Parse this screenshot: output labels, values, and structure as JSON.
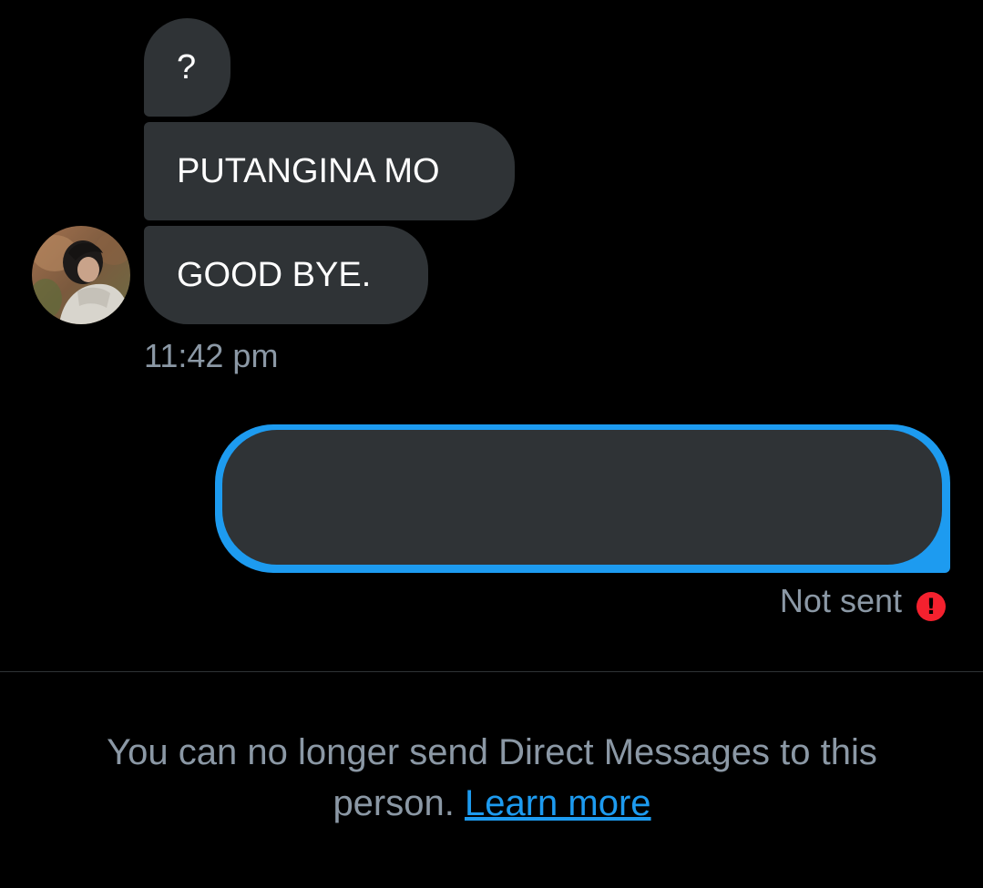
{
  "conversation": {
    "messages_received": [
      {
        "text": "?"
      },
      {
        "text": "PUTANGINA MO"
      },
      {
        "text": "GOOD BYE."
      }
    ],
    "received_timestamp": "11:42 pm",
    "sent_message": {
      "text": "",
      "status": "Not sent",
      "status_icon": "error-icon"
    }
  },
  "footer": {
    "notice_text": "You can no longer send Direct Messages to this person.",
    "learn_more_label": "Learn more"
  },
  "colors": {
    "background": "#000000",
    "received_bubble": "#2f3336",
    "sent_bubble_accent": "#1d9bf0",
    "error": "#f4212e",
    "muted_text": "#8b98a5",
    "link": "#1d9bf0"
  }
}
